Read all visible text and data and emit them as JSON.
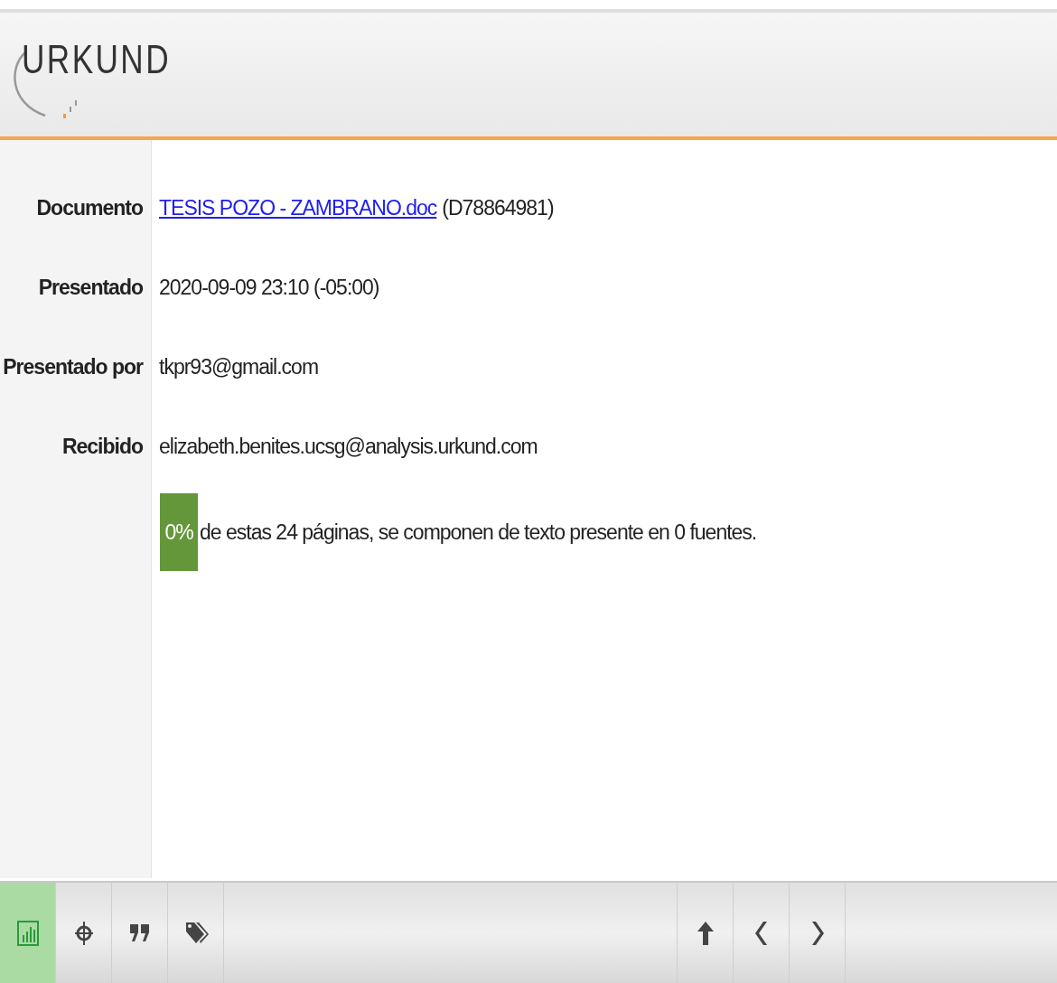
{
  "header": {
    "logo": "URKUND"
  },
  "details": [
    {
      "label": "Documento",
      "link": "TESIS POZO - ZAMBRANO.doc",
      "value": "(D78864981)"
    },
    {
      "label": "Presentado",
      "value": "2020-09-09 23:10 (-05:00)"
    },
    {
      "label": "Presentado por",
      "value": "tkpr93@gmail.com"
    },
    {
      "label": "Recibido",
      "value": "elizabeth.benites.ucsg@analysis.urkund.com"
    }
  ],
  "score": {
    "badge": "0%",
    "text": "de estas 24 páginas, se componen de texto presente en 0 fuentes."
  },
  "toolbar": {
    "left": [
      {
        "kind": "chart",
        "selected": true
      },
      {
        "kind": "target",
        "selected": false
      },
      {
        "kind": "quote",
        "selected": false
      },
      {
        "kind": "tag",
        "selected": false
      }
    ],
    "right": [
      {
        "kind": "up",
        "selected": false
      },
      {
        "kind": "prev",
        "selected": false
      },
      {
        "kind": "next",
        "selected": false
      }
    ]
  }
}
